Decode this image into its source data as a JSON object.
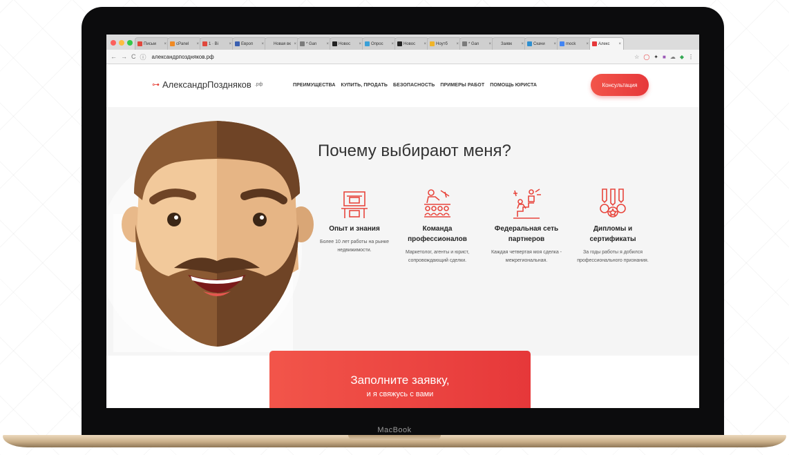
{
  "browser": {
    "tabs": [
      {
        "label": "Письм",
        "color": "#e0483d"
      },
      {
        "label": "cPanel",
        "color": "#f08a24"
      },
      {
        "label": "1 · Bi",
        "color": "#e0483d"
      },
      {
        "label": "Европ",
        "color": "#3a5fb0"
      },
      {
        "label": "Новая вк",
        "color": "#cfcfcf"
      },
      {
        "label": "* Gan",
        "color": "#7b7b7b"
      },
      {
        "label": "Новос",
        "color": "#222222"
      },
      {
        "label": "Опрос",
        "color": "#3aa0d8"
      },
      {
        "label": "Новос",
        "color": "#222222"
      },
      {
        "label": "Ноутб",
        "color": "#f0b429"
      },
      {
        "label": "* Gan",
        "color": "#7b7b7b"
      },
      {
        "label": "Заявк",
        "color": "#cfcfcf"
      },
      {
        "label": "Скачи",
        "color": "#2f8fd0"
      },
      {
        "label": "mock",
        "color": "#4285f4"
      },
      {
        "label": "Алекс",
        "color": "#e6383a"
      }
    ],
    "url": "александрпозднякoв.рф"
  },
  "header": {
    "logo_name": "АлександрПозднякoв",
    "logo_suffix": ".рф",
    "nav": [
      "ПРЕИМУЩЕСТВА",
      "КУПИТЬ, ПРОДАТЬ",
      "БЕЗОПАСНОСТЬ",
      "ПРИМЕРЫ РАБОТ",
      "ПОМОЩЬ ЮРИСТА"
    ],
    "cta": "Консультация"
  },
  "hero": {
    "title": "Почему выбирают меня?"
  },
  "features": [
    {
      "icon": "desk-icon",
      "title": "Опыт и знания",
      "text": "Более 10 лет работы на рынке недвижимости."
    },
    {
      "icon": "team-icon",
      "title": "Команда профессионалов",
      "text": "Маркетолог, агенты и юрист, сопровождающий сделки."
    },
    {
      "icon": "network-icon",
      "title": "Федеральная сеть партнеров",
      "text": "Каждая четвертая моя сделка - межрегиональная."
    },
    {
      "icon": "medals-icon",
      "title": "Дипломы и сертификаты",
      "text": "За годы работы я добился профессионального признания."
    }
  ],
  "order": {
    "title": "Заполните заявку,",
    "subtitle": "и я свяжусь с вами"
  },
  "device": {
    "label": "MacBook"
  },
  "colors": {
    "accent": "#e8453c"
  }
}
